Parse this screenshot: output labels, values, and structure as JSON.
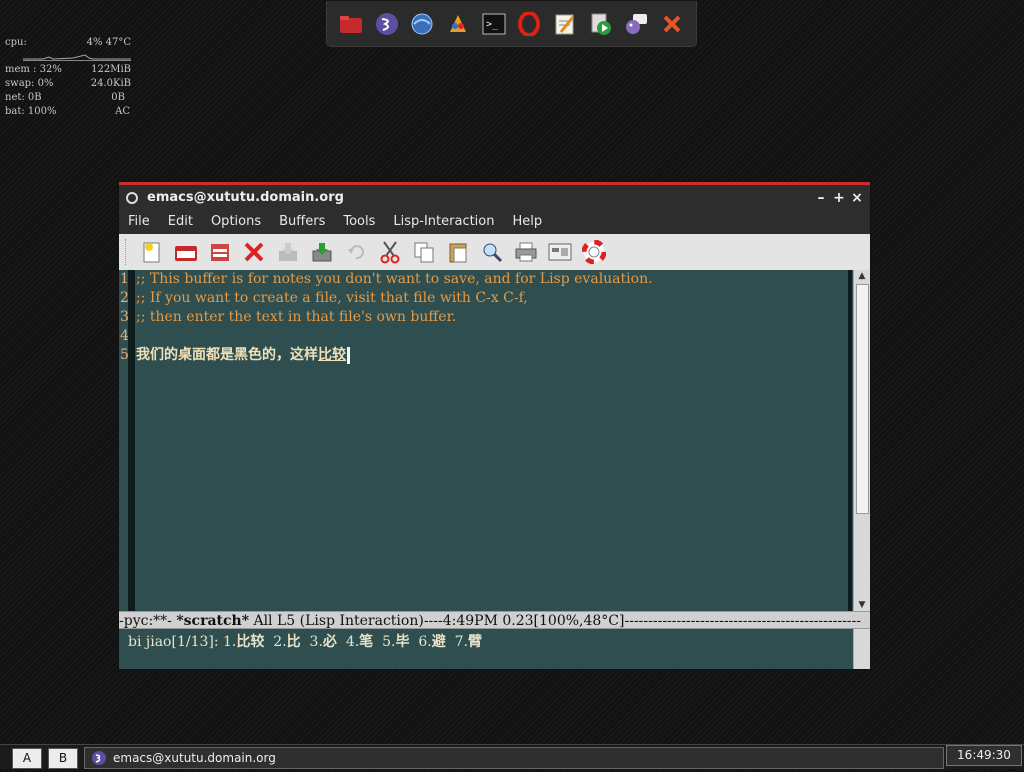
{
  "conky": {
    "cpu_label": "cpu:",
    "cpu_value": "4% 47°C",
    "mem_label": "mem : 32%",
    "mem_value": "122MiB",
    "swap_label": "swap: 0%",
    "swap_value": "24.0KiB",
    "net_label": "net: 0B",
    "net_value": "0B",
    "bat_label": "bat: 100%",
    "bat_value": "AC"
  },
  "dock": {
    "icons": [
      "folder-icon",
      "emacs-icon",
      "browser-icon",
      "paint-icon",
      "terminal-icon",
      "opera-icon",
      "text-editor-icon",
      "media-player-icon",
      "chat-icon",
      "close-icon"
    ]
  },
  "window": {
    "title": "emacs@xututu.domain.org",
    "controls": {
      "minimize": "–",
      "maximize": "+",
      "close": "×"
    },
    "menu": [
      "File",
      "Edit",
      "Options",
      "Buffers",
      "Tools",
      "Lisp-Interaction",
      "Help"
    ],
    "toolbar_icons": [
      "new-file-icon",
      "open-file-icon",
      "dired-icon",
      "kill-buffer-icon",
      "save-icon",
      "save-as-icon",
      "undo-icon",
      "cut-icon",
      "copy-icon",
      "paste-icon",
      "search-icon",
      "print-icon",
      "customize-icon",
      "help-icon"
    ]
  },
  "editor": {
    "line_numbers": [
      "1",
      "2",
      "3",
      "4",
      "5"
    ],
    "lines": [
      ";; This buffer is for notes you don't want to save, and for Lisp evaluation.",
      ";; If you want to create a file, visit that file with C-x C-f,",
      ";; then enter the text in that file's own buffer.",
      ""
    ],
    "input_committed": "我们的桌面都是黑色的，这样",
    "input_preedit": "比较"
  },
  "modeline": {
    "prefix": "-pyc:**-  ",
    "buffer": "*scratch*",
    "rest": "      All L5     (Lisp Interaction)----4:49PM 0.23[100%,48°C]--------------------------------------------------"
  },
  "minibuffer": {
    "prefix": "bi jiao[1/13]: ",
    "candidates": [
      {
        "n": "1.",
        "w": "比较"
      },
      {
        "n": "2.",
        "w": "比"
      },
      {
        "n": "3.",
        "w": "必"
      },
      {
        "n": "4.",
        "w": "笔"
      },
      {
        "n": "5.",
        "w": "毕"
      },
      {
        "n": "6.",
        "w": "避"
      },
      {
        "n": "7.",
        "w": "臂"
      }
    ]
  },
  "taskbar": {
    "workspace_a": "A",
    "workspace_b": "B",
    "task_title": "emacs@xututu.domain.org",
    "clock": "16:49:30"
  }
}
